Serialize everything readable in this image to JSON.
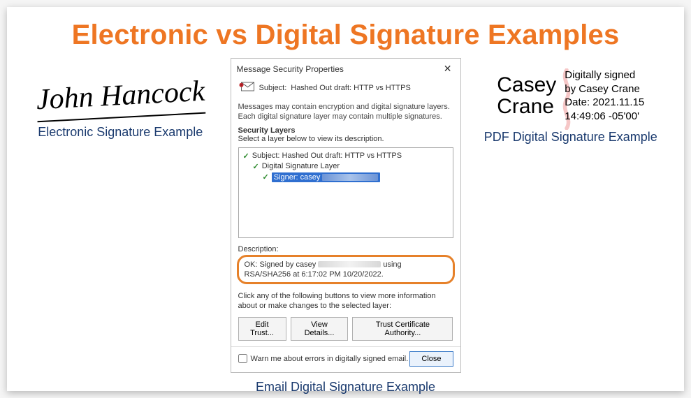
{
  "title": "Electronic vs Digital Signature Examples",
  "left": {
    "signature_text": "John Hancock",
    "caption": "Electronic Signature Example"
  },
  "email": {
    "window_title": "Message Security Properties",
    "subject_label": "Subject:",
    "subject_value": "Hashed Out draft: HTTP vs HTTPS",
    "info_text": "Messages may contain encryption and digital signature layers. Each digital signature layer may contain multiple signatures.",
    "security_layers_heading": "Security Layers",
    "select_layer_instruction": "Select a layer below to view its description.",
    "tree": {
      "node_subject": "Subject: Hashed Out draft: HTTP vs HTTPS",
      "node_layer": "Digital Signature Layer",
      "node_signer_prefix": "Signer: casey"
    },
    "description_label": "Description:",
    "description_prefix": "OK: Signed by casey",
    "description_suffix": "using RSA/SHA256 at 6:17:02 PM 10/20/2022.",
    "more_info_text": "Click any of the following buttons to view more information about or make changes to the selected layer:",
    "buttons": {
      "edit_trust": "Edit Trust...",
      "view_details": "View Details...",
      "trust_ca": "Trust Certificate Authority..."
    },
    "warn_checkbox": "Warn me about errors in digitally signed email.",
    "close": "Close",
    "caption": "Email Digital Signature Example"
  },
  "pdf": {
    "name_line1": "Casey",
    "name_line2": "Crane",
    "line1": "Digitally signed",
    "line2": "by Casey Crane",
    "line3": "Date: 2021.11.15",
    "line4": "14:49:06 -05'00'",
    "caption": "PDF Digital Signature Example"
  }
}
